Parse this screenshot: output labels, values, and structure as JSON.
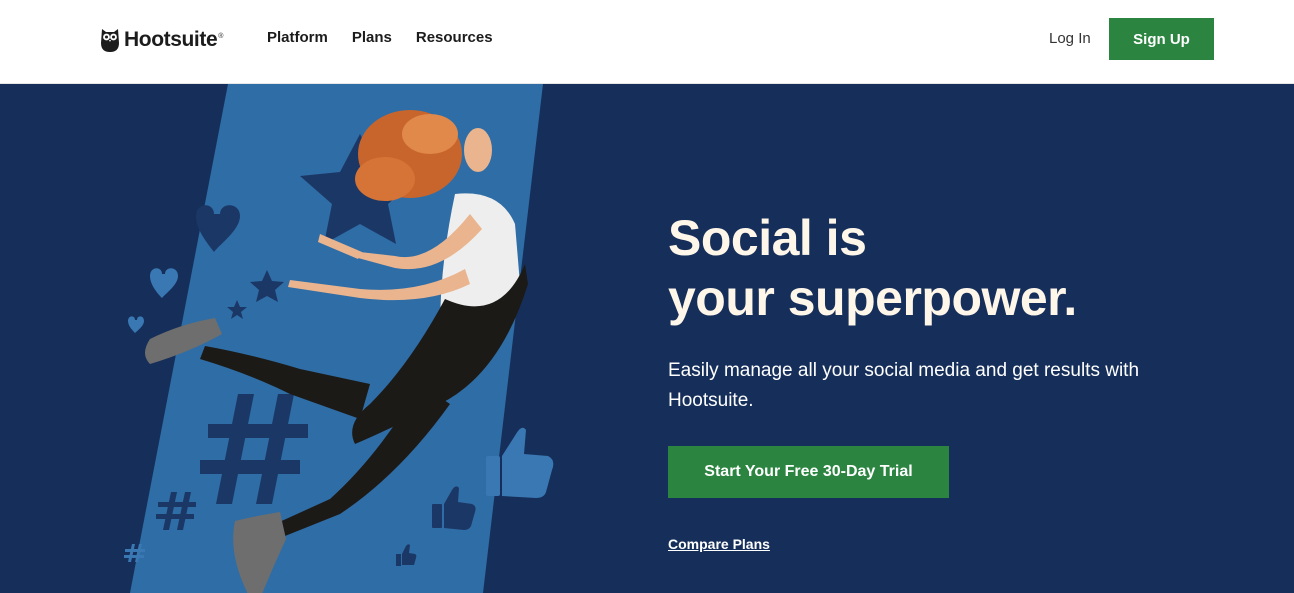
{
  "header": {
    "logo_text": "Hootsuite",
    "logo_tm": "®",
    "nav": [
      {
        "label": "Platform"
      },
      {
        "label": "Plans"
      },
      {
        "label": "Resources"
      }
    ],
    "login_label": "Log In",
    "signup_label": "Sign Up"
  },
  "hero": {
    "title_line1": "Social is",
    "title_line2": "your superpower.",
    "subtitle": "Easily manage all your social media and get results with Hootsuite.",
    "cta_label": "Start Your Free 30-Day Trial",
    "compare_label": "Compare Plans"
  },
  "colors": {
    "hero_background": "#162f5a",
    "art_stripe": "#2f6da6",
    "brand_green": "#2b8541",
    "title_cream": "#fff6ea"
  },
  "icons": [
    "owl-logo-icon",
    "star-icon",
    "heart-icon",
    "hashtag-icon",
    "thumbs-up-icon"
  ]
}
